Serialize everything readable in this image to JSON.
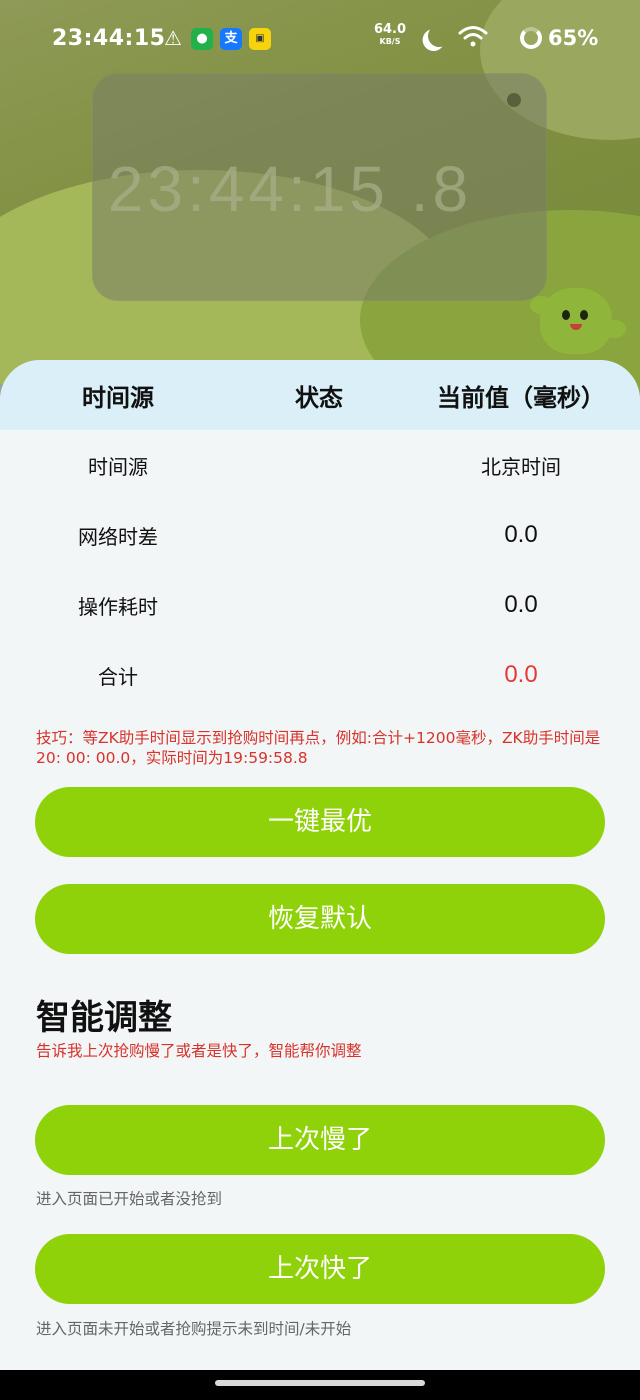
{
  "status_bar": {
    "time": "23:44:15",
    "net_speed": "64.0",
    "net_unit": "KB/S",
    "battery": "65%",
    "app_icons": [
      "warning-icon",
      "green-app-icon",
      "alipay-icon",
      "yellow-app-icon"
    ],
    "alipay_glyph": "支"
  },
  "clock": {
    "display": "23:44:15 .8"
  },
  "table": {
    "headers": [
      "时间源",
      "状态",
      "当前值（毫秒）"
    ],
    "rows": [
      {
        "label": "时间源",
        "value": "北京时间"
      },
      {
        "label": "网络时差",
        "value": "0.0"
      },
      {
        "label": "操作耗时",
        "value": "0.0"
      },
      {
        "label": "合计",
        "value": "0.0"
      }
    ]
  },
  "tip": "技巧：等ZK助手时间显示到抢购时间再点，例如:合计+1200毫秒，ZK助手时间是20: 00: 00.0，实际时间为19:59:58.8",
  "buttons": {
    "optimal": "一键最优",
    "restore": "恢复默认"
  },
  "smart": {
    "title": "智能调整",
    "subtitle": "告诉我上次抢购慢了或者是快了，智能帮你调整",
    "slow_button": "上次慢了",
    "slow_hint": "进入页面已开始或者没抢到",
    "fast_button": "上次快了",
    "fast_hint": "进入页面未开始或者抢购提示未到时间/未开始"
  },
  "colors": {
    "accent_button": "#8fd20a",
    "header_bg": "#daeff8",
    "warning_text": "#d8322a",
    "total_value": "#e53935"
  }
}
